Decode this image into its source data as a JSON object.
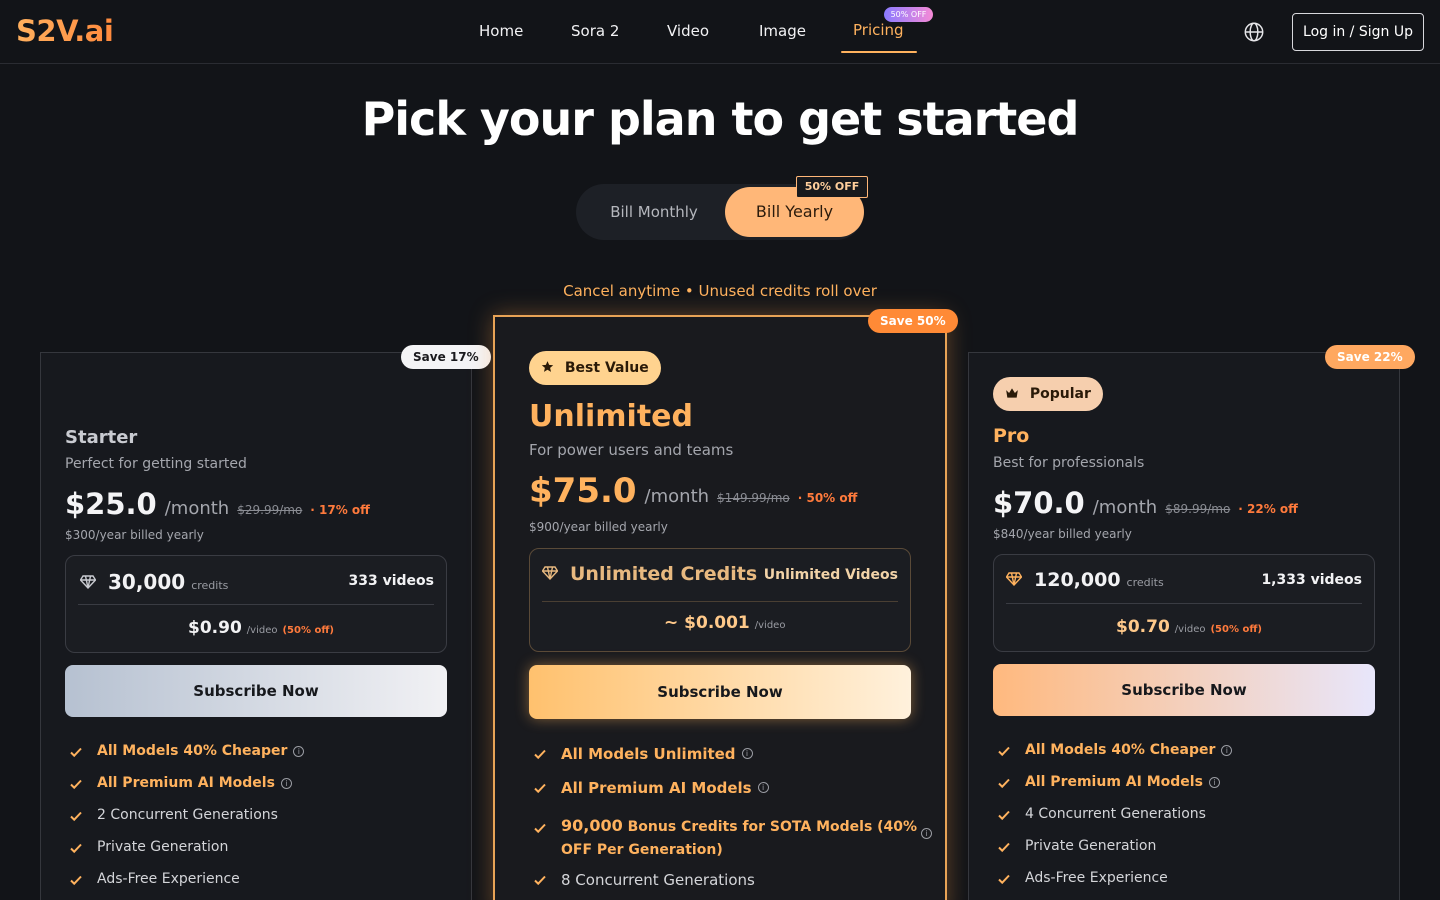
{
  "header": {
    "logo": "S2V.ai",
    "nav": [
      {
        "label": "Home"
      },
      {
        "label": "Sora 2"
      },
      {
        "label": "Video"
      },
      {
        "label": "Image"
      },
      {
        "label": "Pricing",
        "active": true,
        "badge": "50% OFF"
      }
    ],
    "login_label": "Log in / Sign Up",
    "globe_icon": "globe-icon"
  },
  "hero": {
    "title": "Pick your plan to get started",
    "toggle": {
      "monthly_label": "Bill Monthly",
      "yearly_label": "Bill Yearly",
      "selected": "yearly",
      "badge": "50% OFF"
    },
    "cancel_note": "Cancel anytime • Unused credits roll over"
  },
  "colors": {
    "accent": "#ffb25e",
    "off": "#ff7a3c",
    "background": "#121418",
    "featured_border": "#e8a356"
  },
  "plans": [
    {
      "id": "starter",
      "save_badge": "Save 17%",
      "name": "Starter",
      "subtitle": "Perfect for getting started",
      "price": "$25.0",
      "per": "/month",
      "old_price": "$29.99/mo",
      "off": "· 17% off",
      "billed": "$300/year billed yearly",
      "credits": "30,000",
      "credits_unit": "credits",
      "videos": "333 videos",
      "per_video": "$0.90",
      "per_video_unit": "/video",
      "per_video_off": "(50% off)",
      "cta": "Subscribe Now",
      "features": [
        {
          "text": "All Models 40% Cheaper",
          "highlight": true,
          "info": true
        },
        {
          "text": "All Premium AI Models",
          "highlight": true,
          "info": true
        },
        {
          "text": "2 Concurrent Generations"
        },
        {
          "text": "Private Generation"
        },
        {
          "text": "Ads-Free Experience"
        }
      ]
    },
    {
      "id": "unlimited",
      "save_badge": "Save 50%",
      "tag": "Best Value",
      "tag_icon": "star-icon",
      "name": "Unlimited",
      "subtitle": "For power users and teams",
      "price": "$75.0",
      "per": "/month",
      "old_price": "$149.99/mo",
      "off": "· 50% off",
      "billed": "$900/year billed yearly",
      "credits": "Unlimited Credits",
      "videos": "Unlimited Videos",
      "per_video": "~ $0.001",
      "per_video_unit": "/video",
      "cta": "Subscribe Now",
      "features": [
        {
          "text": "All Models Unlimited",
          "highlight": true,
          "info": true
        },
        {
          "text": "All Premium AI Models",
          "highlight": true,
          "info": true
        },
        {
          "strong": "90,000",
          "text": " Bonus Credits for SOTA Models (40%",
          "text2": "OFF Per Generation)",
          "highlight": true,
          "info": true
        },
        {
          "text": "8 Concurrent Generations"
        }
      ]
    },
    {
      "id": "pro",
      "save_badge": "Save 22%",
      "tag": "Popular",
      "tag_icon": "crown-icon",
      "name": "Pro",
      "subtitle": "Best for professionals",
      "price": "$70.0",
      "per": "/month",
      "old_price": "$89.99/mo",
      "off": "· 22% off",
      "billed": "$840/year billed yearly",
      "credits": "120,000",
      "credits_unit": "credits",
      "videos": "1,333 videos",
      "per_video": "$0.70",
      "per_video_unit": "/video",
      "per_video_off": "(50% off)",
      "cta": "Subscribe Now",
      "features": [
        {
          "text": "All Models 40% Cheaper",
          "highlight": true,
          "info": true
        },
        {
          "text": "All Premium AI Models",
          "highlight": true,
          "info": true
        },
        {
          "text": "4 Concurrent Generations"
        },
        {
          "text": "Private Generation"
        },
        {
          "text": "Ads-Free Experience"
        }
      ]
    }
  ]
}
